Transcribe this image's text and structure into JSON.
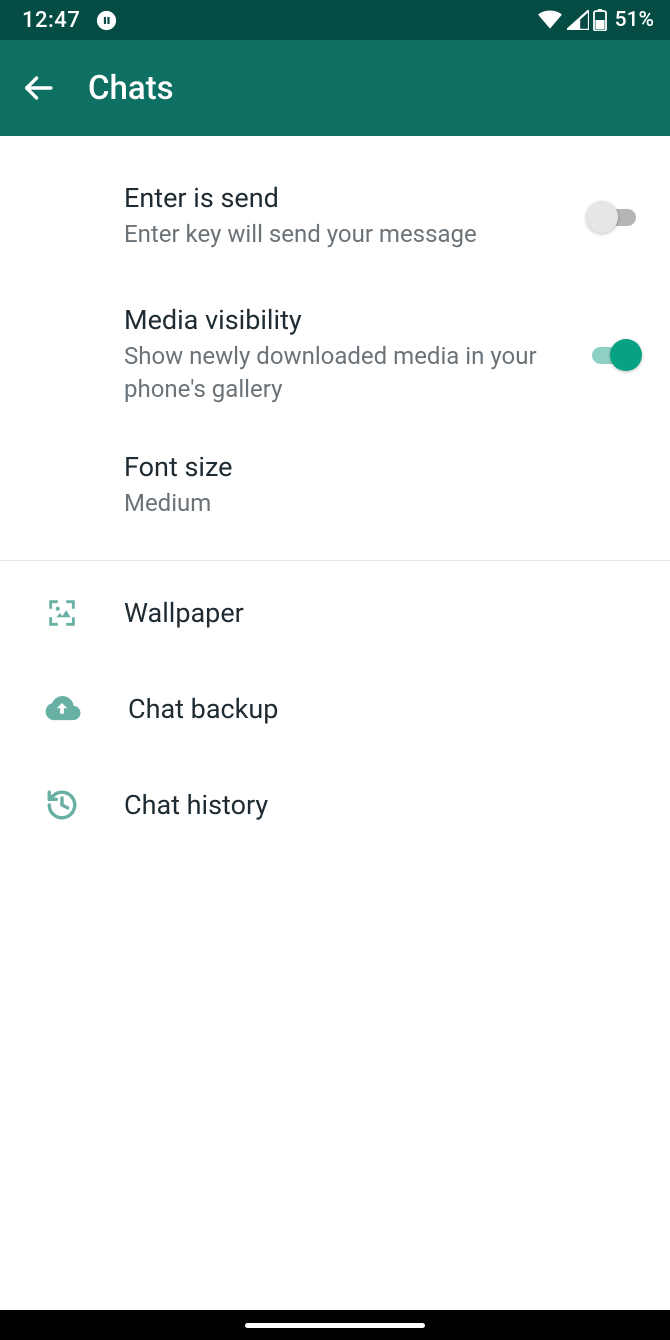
{
  "status": {
    "time": "12:47",
    "battery_pct": "51%"
  },
  "header": {
    "title": "Chats"
  },
  "settings": {
    "enter_is_send": {
      "title": "Enter is send",
      "subtitle": "Enter key will send your message",
      "enabled": false
    },
    "media_visibility": {
      "title": "Media visibility",
      "subtitle": "Show newly downloaded media in your phone's gallery",
      "enabled": true
    },
    "font_size": {
      "title": "Font size",
      "value": "Medium"
    },
    "wallpaper": {
      "title": "Wallpaper"
    },
    "chat_backup": {
      "title": "Chat backup"
    },
    "chat_history": {
      "title": "Chat history"
    }
  },
  "colors": {
    "primary": "#0e7063",
    "status_bar": "#054d44",
    "accent": "#07a283",
    "icon_tint": "#67b0a3"
  }
}
